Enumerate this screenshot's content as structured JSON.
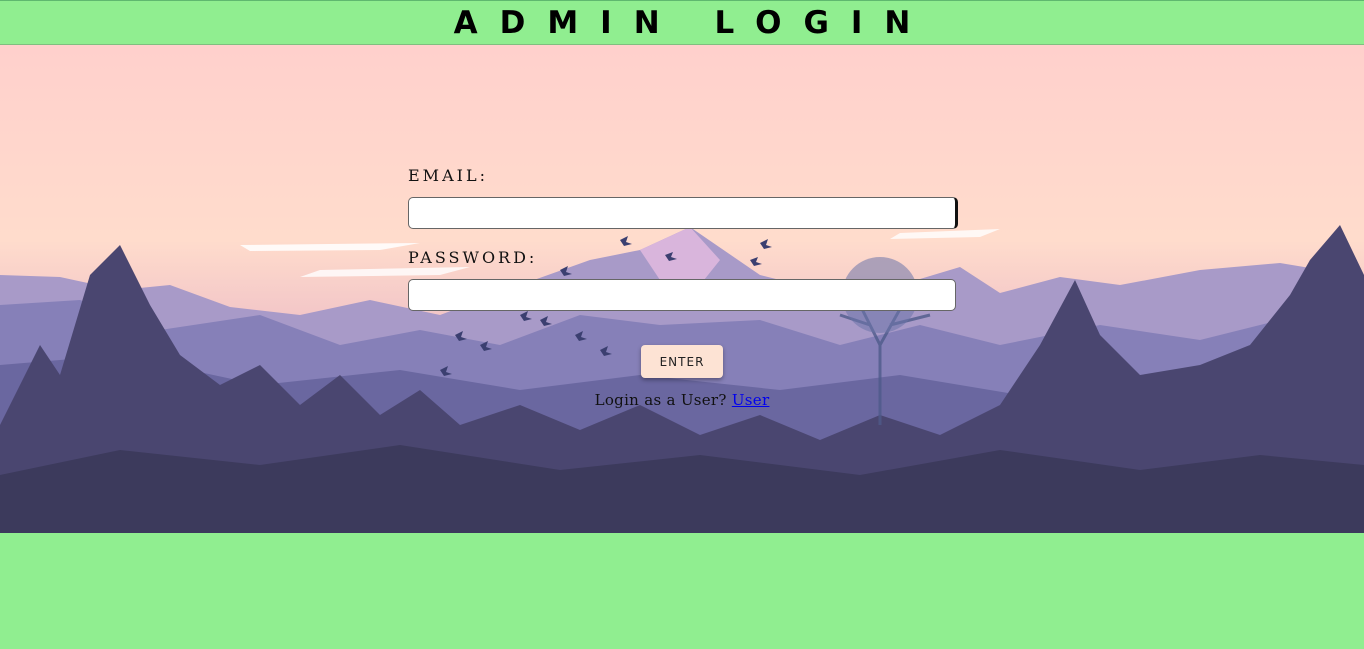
{
  "header": {
    "title": "ADMIN LOGIN"
  },
  "form": {
    "email_label": "EMAIL:",
    "email_value": "",
    "password_label": "PASSWORD:",
    "password_value": "",
    "enter_label": "ENTER",
    "user_prompt": "Login as a User?",
    "user_link": "User"
  },
  "colors": {
    "header_bg": "#90ee90",
    "button_bg": "#fde3d4",
    "link": "#0000ee"
  }
}
